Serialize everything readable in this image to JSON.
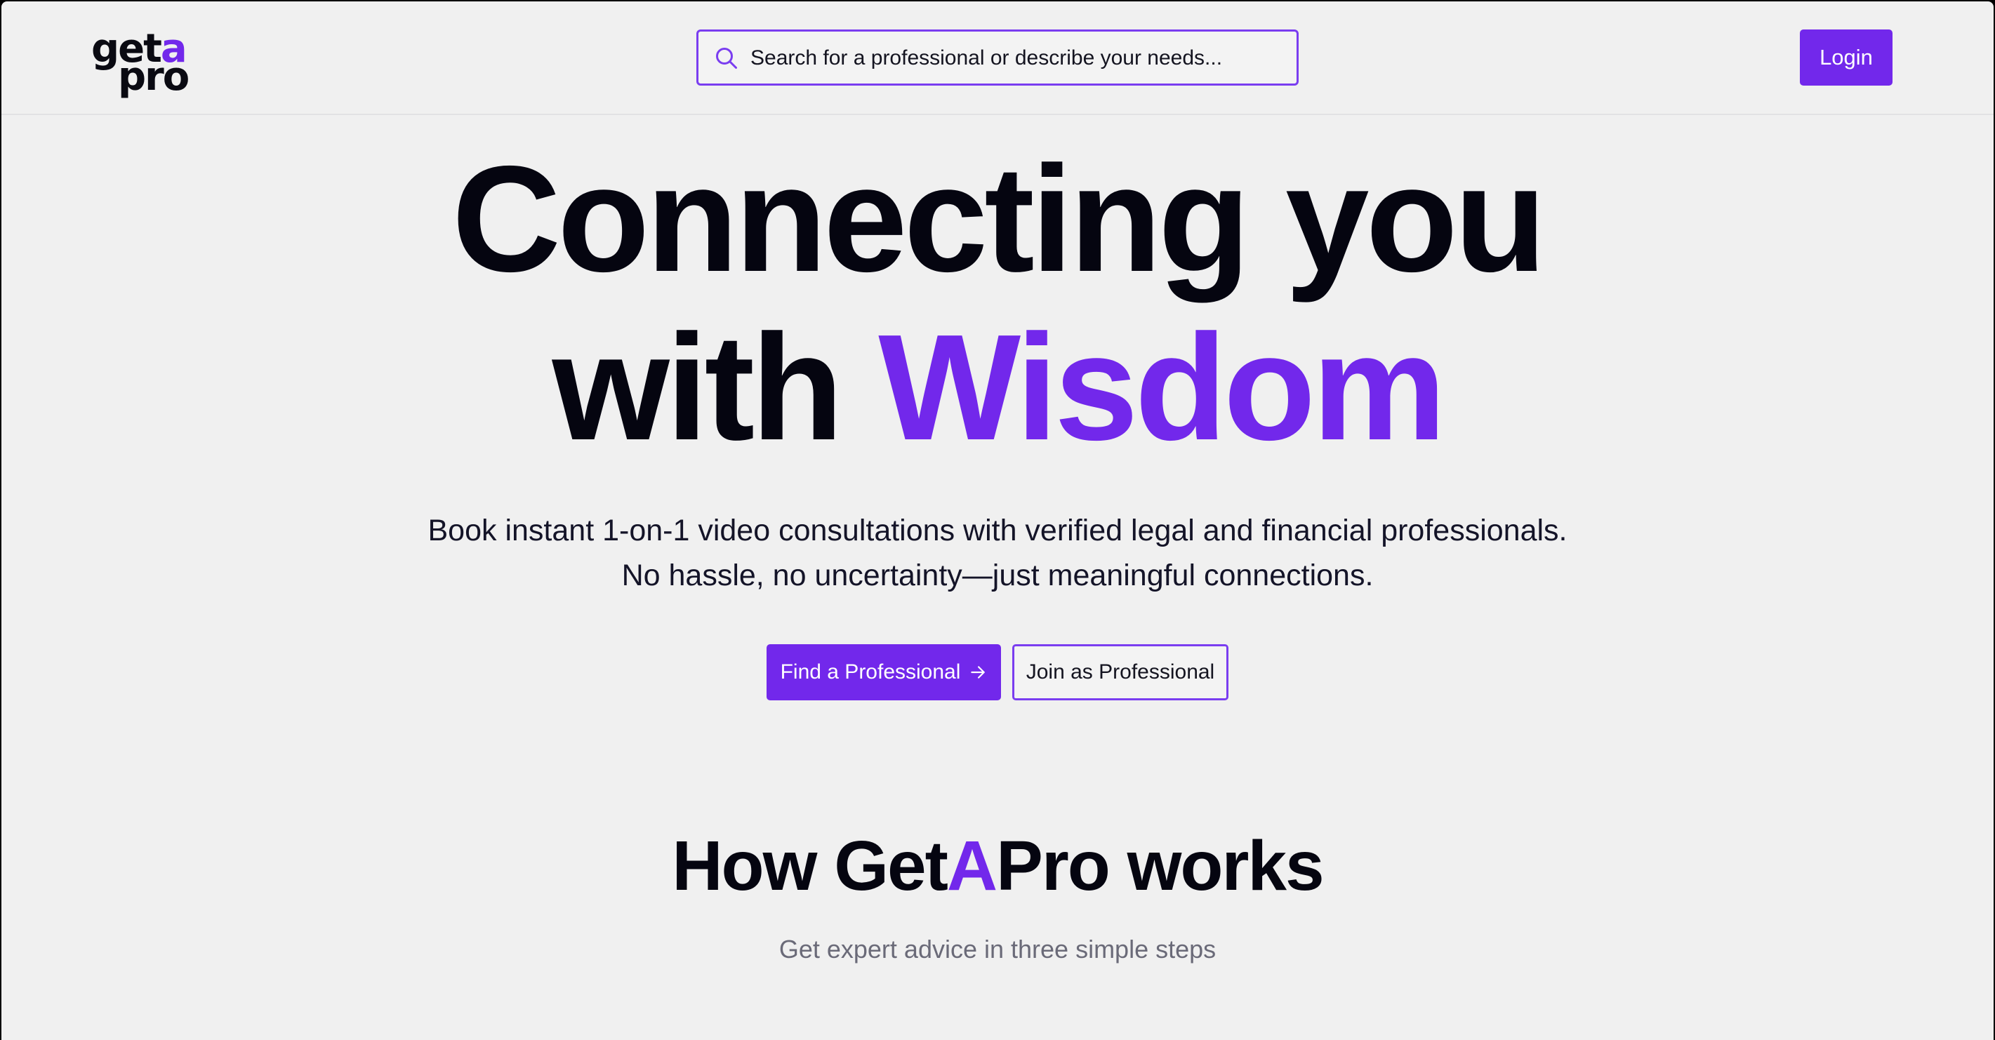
{
  "brand": {
    "logo_line1_prefix": "get",
    "logo_line1_accent": "a",
    "logo_line2": "pro",
    "accent_color": "#7228eb",
    "text_color": "#050510",
    "background_color": "#f0f0f0"
  },
  "header": {
    "search": {
      "icon": "search-icon",
      "placeholder": "Search for a professional or describe your needs..."
    },
    "login_label": "Login"
  },
  "hero": {
    "title_line1": "Connecting you",
    "title_line2_prefix": "with ",
    "title_line2_accent": "Wisdom",
    "subtitle_line1": "Book instant 1-on-1 video consultations with verified legal and financial professionals.",
    "subtitle_line2": "No hassle, no uncertainty—just meaningful connections.",
    "primary_button_label": "Find a Professional",
    "primary_button_icon": "arrow-right-icon",
    "secondary_button_label": "Join as Professional"
  },
  "how_it_works": {
    "title_prefix": "How Get",
    "title_accent": "A",
    "title_suffix": "Pro works",
    "subtitle": "Get expert advice in three simple steps"
  }
}
